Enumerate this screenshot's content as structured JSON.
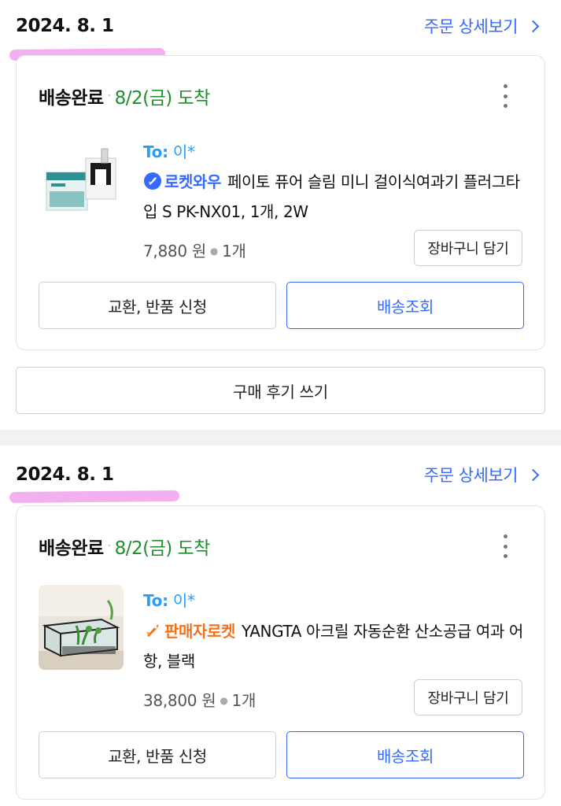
{
  "orders": [
    {
      "date": "2024. 8. 1",
      "detail_link": "주문 상세보기",
      "status": "배송완료",
      "arrival": "8/2(금) 도착",
      "to_label": "To:",
      "to_name": "이*",
      "badge": "로켓와우",
      "badge_color": "#346aff",
      "product_name": "페이토 퓨어 슬림 미니 걸이식여과기 플러그타입 S PK-NX01, 1개, 2W",
      "price": "7,880 원",
      "quantity": "1개",
      "cart_button": "장바구니 담기",
      "exchange_button": "교환, 반품 신청",
      "track_button": "배송조회",
      "image_icon": "filter-product-image"
    },
    {
      "date": "2024. 8. 1",
      "detail_link": "주문 상세보기",
      "status": "배송완료",
      "arrival": "8/2(금) 도착",
      "to_label": "To:",
      "to_name": "이*",
      "badge": "판매자로켓",
      "badge_color": "#f4711b",
      "product_name": "YANGTA 아크릴 자동순환 산소공급 여과 어항, 블랙",
      "price": "38,800 원",
      "quantity": "1개",
      "cart_button": "장바구니 담기",
      "exchange_button": "교환, 반품 신청",
      "track_button": "배송조회",
      "image_icon": "aquarium-product-image"
    }
  ],
  "review_button": "구매 후기 쓰기",
  "colors": {
    "accent_blue": "#346aff",
    "arrival_green": "#1f8f2e",
    "to_blue": "#2a9df4",
    "highlight_pink": "#f3a6f0"
  }
}
